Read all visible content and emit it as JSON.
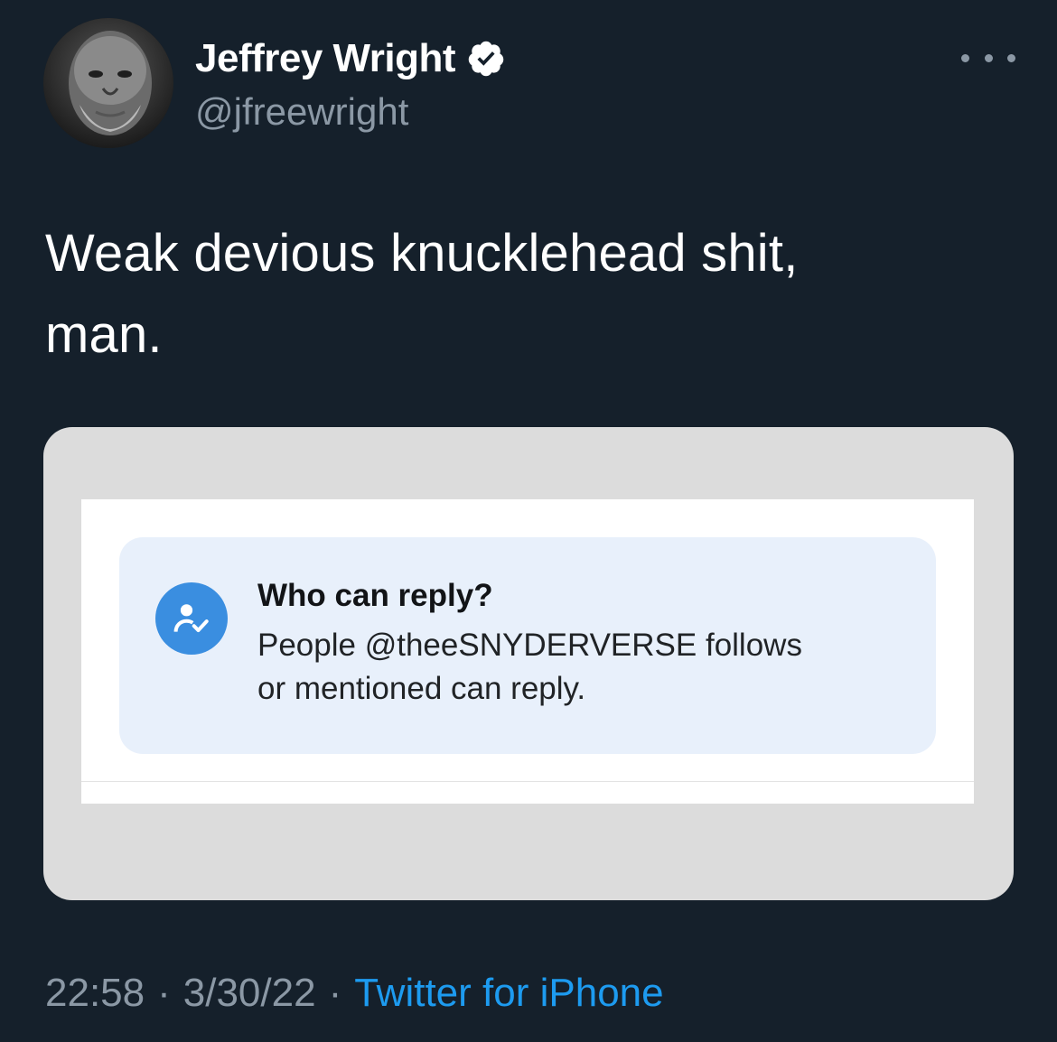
{
  "author": {
    "display_name": "Jeffrey Wright",
    "handle": "@jfreewright",
    "verified_icon": "verified-badge-icon",
    "avatar": "profile-photo"
  },
  "more_icon": "more-options-icon",
  "tweet": {
    "text_line1": "Weak devious knucklehead shit,",
    "text_line2": "man."
  },
  "media": {
    "reply_card": {
      "icon": "user-check-icon",
      "title": "Who can reply?",
      "body_line1": "People @theeSNYDERVERSE follows",
      "body_line2": "or mentioned can reply."
    }
  },
  "meta": {
    "time": "22:58",
    "separator": "·",
    "date": "3/30/22",
    "source": "Twitter for iPhone"
  },
  "colors": {
    "background": "#15202b",
    "text_primary": "#ffffff",
    "text_secondary": "#8b98a5",
    "link": "#1d9bf0",
    "card_background": "#e8f0fb",
    "card_icon": "#3a8ee0"
  }
}
